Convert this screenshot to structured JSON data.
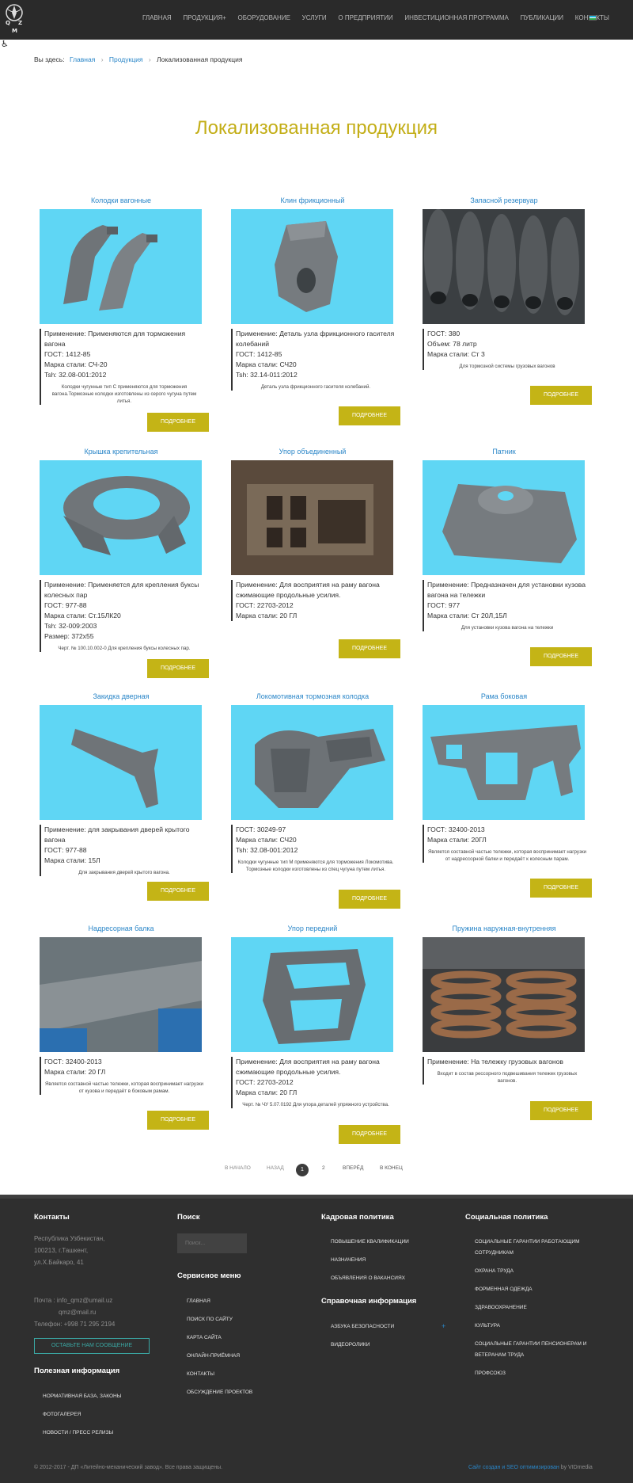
{
  "header": {
    "logo_text": "Q Z M",
    "nav": [
      "ГЛАВНАЯ",
      "ПРОДУКЦИЯ",
      "ОБОРУДОВАНИЕ",
      "УСЛУГИ",
      "О ПРЕДПРИЯТИИ",
      "ИНВЕСТИЦИОННАЯ ПРОГРАММА",
      "ПУБЛИКАЦИИ",
      "КОНТАКТЫ"
    ],
    "nav_submenu_marker": "+",
    "flag_icon": "uzbekistan-flag-icon",
    "accessibility_icon": "wheelchair-icon"
  },
  "breadcrumb": {
    "prefix": "Вы здесь:",
    "items": [
      "Главная",
      "Продукция",
      "Локализованная продукция"
    ],
    "separator": "›"
  },
  "page_title": "Локализованная продукция",
  "button_label": "ПОДРОБНЕЕ",
  "products": [
    {
      "title": "Колодки вагонные",
      "specs": [
        {
          "k": "Применение:",
          "v": "Применяются для торможения вагона"
        },
        {
          "k": "ГОСТ:",
          "v": "1412-85"
        },
        {
          "k": "Марка стали:",
          "v": "СЧ-20"
        },
        {
          "k": "Tsh:",
          "v": "32.08-001:2012"
        }
      ],
      "desc": "Колодки чугунные тип С применяются для торможения вагона.Тормозные колодки изготовлены из серого чугуна путем литья."
    },
    {
      "title": "Клин фрикционный",
      "specs": [
        {
          "k": "Применение:",
          "v": "Деталь узла фрикционного гасителя колебаний"
        },
        {
          "k": "ГОСТ:",
          "v": "1412-85"
        },
        {
          "k": "Марка стали:",
          "v": "СЧ20"
        },
        {
          "k": "Tsh:",
          "v": "32.14-011:2012"
        }
      ],
      "desc": "Деталь узла фрикционного гасителя колебаний."
    },
    {
      "title": "Запасной резервуар",
      "specs": [
        {
          "k": "ГОСТ:",
          "v": "380"
        },
        {
          "k": "Объем:",
          "v": "78 литр"
        },
        {
          "k": "Марка стали:",
          "v": "Ст 3"
        }
      ],
      "desc": "Для тормозной системы грузовых вагонов"
    },
    {
      "title": "Крышка крепительная",
      "specs": [
        {
          "k": "Применение:",
          "v": "Применяется для крепления буксы колесных пар"
        },
        {
          "k": "ГОСТ:",
          "v": "977-88"
        },
        {
          "k": "Марка стали:",
          "v": "Ст.15ЛК20"
        },
        {
          "k": "Tsh:",
          "v": "32-009:2003"
        },
        {
          "k": "Размер:",
          "v": "372х55"
        }
      ],
      "desc": "Черт. № 100.10.002-0 Для крепления буксы колесных пар."
    },
    {
      "title": "Упор объединенный",
      "specs": [
        {
          "k": "Применение:",
          "v": "Для восприятия на раму вагона сжимающие продольные усилия."
        },
        {
          "k": "ГОСТ:",
          "v": "22703-2012"
        },
        {
          "k": "Марка стали:",
          "v": "20 ГЛ"
        }
      ],
      "desc": ""
    },
    {
      "title": "Патник",
      "specs": [
        {
          "k": "Применение:",
          "v": "Предназначен для установки кузова вагона на тележки"
        },
        {
          "k": "ГОСТ:",
          "v": "977"
        },
        {
          "k": "Марка стали:",
          "v": "Ст 20Л,15Л"
        }
      ],
      "desc": "Для установки кузова вагона на тележки"
    },
    {
      "title": "Закидка дверная",
      "specs": [
        {
          "k": "Применение:",
          "v": "для закрывания дверей крытого вагона"
        },
        {
          "k": "ГОСТ:",
          "v": "977-88"
        },
        {
          "k": "Марка стали:",
          "v": "15Л"
        }
      ],
      "desc": "Для закрывания дверей крытого вагона."
    },
    {
      "title": "Локомотивная тормозная колодка",
      "specs": [
        {
          "k": "ГОСТ:",
          "v": "30249-97"
        },
        {
          "k": "Марка стали:",
          "v": "СЧ20"
        },
        {
          "k": "Tsh:",
          "v": "32.08-001:2012"
        }
      ],
      "desc": "Колодки чугунные тип М применяются для торможения Локомотива. Тормозные колодки изготовлены из спец чугуна путем литья."
    },
    {
      "title": "Рама боковая",
      "specs": [
        {
          "k": "ГОСТ:",
          "v": "32400-2013"
        },
        {
          "k": "Марка стали:",
          "v": "20ГЛ"
        }
      ],
      "desc": "Является составной частью тележки, которая воспринимает нагрузки от надрессорной балки и передаёт к колесным парам."
    },
    {
      "title": "Надресорная балка",
      "specs": [
        {
          "k": "ГОСТ:",
          "v": "32400-2013"
        },
        {
          "k": "Марка стали:",
          "v": "20 ГЛ"
        }
      ],
      "desc": "Является составной частью тележки, которая воспринимает нагрузки от кузова и передаёт в боковым рамам."
    },
    {
      "title": "Упор передний",
      "specs": [
        {
          "k": "Применение:",
          "v": "Для восприятия на раму вагона сжимающие продольные усилия."
        },
        {
          "k": "ГОСТ:",
          "v": "22703-2012"
        },
        {
          "k": "Марка стали:",
          "v": "20 ГЛ"
        }
      ],
      "desc": "Черт. № ЧУ 5.07.0192 Для упора деталей упряжного устройства."
    },
    {
      "title": "Пружина наружная-внутренняя",
      "specs": [
        {
          "k": "Применение:",
          "v": "На тележку грузовых вагонов"
        }
      ],
      "desc": "Входит в состав рессорного подвешивания тележек грузовых вагонов."
    }
  ],
  "pagination": {
    "first": "В НАЧАЛО",
    "prev": "НАЗАД",
    "current": "1",
    "page2": "2",
    "next": "ВПЕРЁД",
    "last": "В КОНЕЦ"
  },
  "footer": {
    "contacts": {
      "heading": "Контакты",
      "address": [
        "Республика Узбекистан,",
        "100213, г.Ташкент,",
        "ул.Х.Байкаро, 41"
      ],
      "mail_label": "Почта :",
      "emails": [
        "info_qmz@umail.uz",
        "qmz@mail.ru"
      ],
      "phone": "Телефон: +998 71 295 2194",
      "button": "ОСТАВЬТЕ НАМ СООБЩЕНИЕ"
    },
    "useful": {
      "heading": "Полезная информация",
      "links": [
        "НОРМАТИВНАЯ БАЗА, ЗАКОНЫ",
        "ФОТОГАЛЕРЕЯ",
        "НОВОСТИ / ПРЕСС РЕЛИЗЫ"
      ]
    },
    "search": {
      "heading": "Поиск",
      "placeholder": "Поиск..."
    },
    "service": {
      "heading": "Сервисное меню",
      "links": [
        "ГЛАВНАЯ",
        "ПОИСК ПО САЙТУ",
        "КАРТА САЙТА",
        "ОНЛАЙН-ПРИЁМНАЯ",
        "КОНТАКТЫ",
        "ОБСУЖДЕНИЕ ПРОЕКТОВ"
      ]
    },
    "hr": {
      "heading": "Кадровая политика",
      "links": [
        "ПОВЫШЕНИЕ КВАЛИФИКАЦИИ",
        "НАЗНАЧЕНИЯ",
        "ОБЪЯВЛЕНИЯ О ВАКАНСИЯХ"
      ]
    },
    "reference": {
      "heading": "Справочная информация",
      "links": [
        "АЗБУКА БЕЗОПАСНОСТИ",
        "ВИДЕОРОЛИКИ"
      ],
      "expand_marker": "+"
    },
    "social": {
      "heading": "Социальная политика",
      "links": [
        "СОЦИАЛЬНЫЕ ГАРАНТИИ РАБОТАЮЩИМ",
        "СОТРУДНИКАМ",
        "ОХРАНА ТРУДА",
        "ФОРМЕННАЯ ОДЕЖДА",
        "ЗДРАВООХРАНЕНИЕ",
        "КУЛЬТУРА",
        "СОЦИАЛЬНЫЕ ГАРАНТИИ ПЕНСИОНЕРАМ И",
        "ВЕТЕРАНАМ ТРУДА",
        "ПРОФСОЮЗ"
      ]
    },
    "copyright": "© 2012-2017 - ДП «Литейно-механический завод». Все права защищены.",
    "credit_link": "Сайт создан и SEO оптимизирован",
    "credit_by": "by VIDmedia"
  }
}
